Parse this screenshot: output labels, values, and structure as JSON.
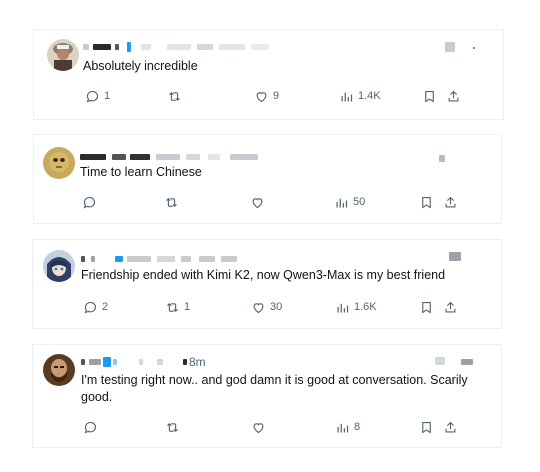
{
  "posts": [
    {
      "text": "Absolutely incredible",
      "time": "",
      "stats": {
        "replies": "1",
        "reposts": "",
        "likes": "9",
        "views": "1.4K"
      }
    },
    {
      "text": "Time to learn Chinese",
      "time": "",
      "stats": {
        "replies": "",
        "reposts": "",
        "likes": "",
        "views": "50"
      }
    },
    {
      "text": "Friendship ended with Kimi K2, now Qwen3-Max is my best friend",
      "time": "",
      "stats": {
        "replies": "2",
        "reposts": "1",
        "likes": "30",
        "views": "1.6K"
      }
    },
    {
      "text": "I'm testing right now.. and god damn it is good at conversation. Scarily good.",
      "time": "8m",
      "stats": {
        "replies": "",
        "reposts": "",
        "likes": "",
        "views": "8"
      }
    }
  ],
  "icons": {
    "reply": "speech-bubble-icon",
    "repost": "repost-arrows-icon",
    "like": "heart-icon",
    "views": "bar-chart-icon",
    "bookmark": "bookmark-icon",
    "share": "share-upload-icon"
  },
  "colors": {
    "text": "#0f1419",
    "muted": "#536471",
    "border": "#eceff1",
    "verified": "#1d9bf0"
  }
}
